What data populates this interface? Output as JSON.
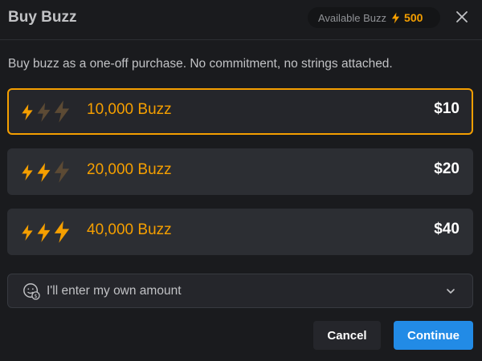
{
  "modal": {
    "title": "Buy Buzz",
    "available_label": "Available Buzz",
    "available_amount": "500",
    "close_icon": "close-icon"
  },
  "description": "Buy buzz as a one-off purchase. No commitment, no strings attached.",
  "options": [
    {
      "label": "10,000 Buzz",
      "price": "$10",
      "active_bolts": 1,
      "selected": true
    },
    {
      "label": "20,000 Buzz",
      "price": "$20",
      "active_bolts": 2,
      "selected": false
    },
    {
      "label": "40,000 Buzz",
      "price": "$40",
      "active_bolts": 3,
      "selected": false
    }
  ],
  "custom_amount": {
    "label": "I'll enter my own amount",
    "icon": "coin-face-icon",
    "chevron": "chevron-down-icon"
  },
  "buttons": {
    "cancel": "Cancel",
    "continue": "Continue"
  },
  "colors": {
    "accent": "#f59f00",
    "primary": "#228be6",
    "bolt_inactive": "#5c4a34"
  }
}
